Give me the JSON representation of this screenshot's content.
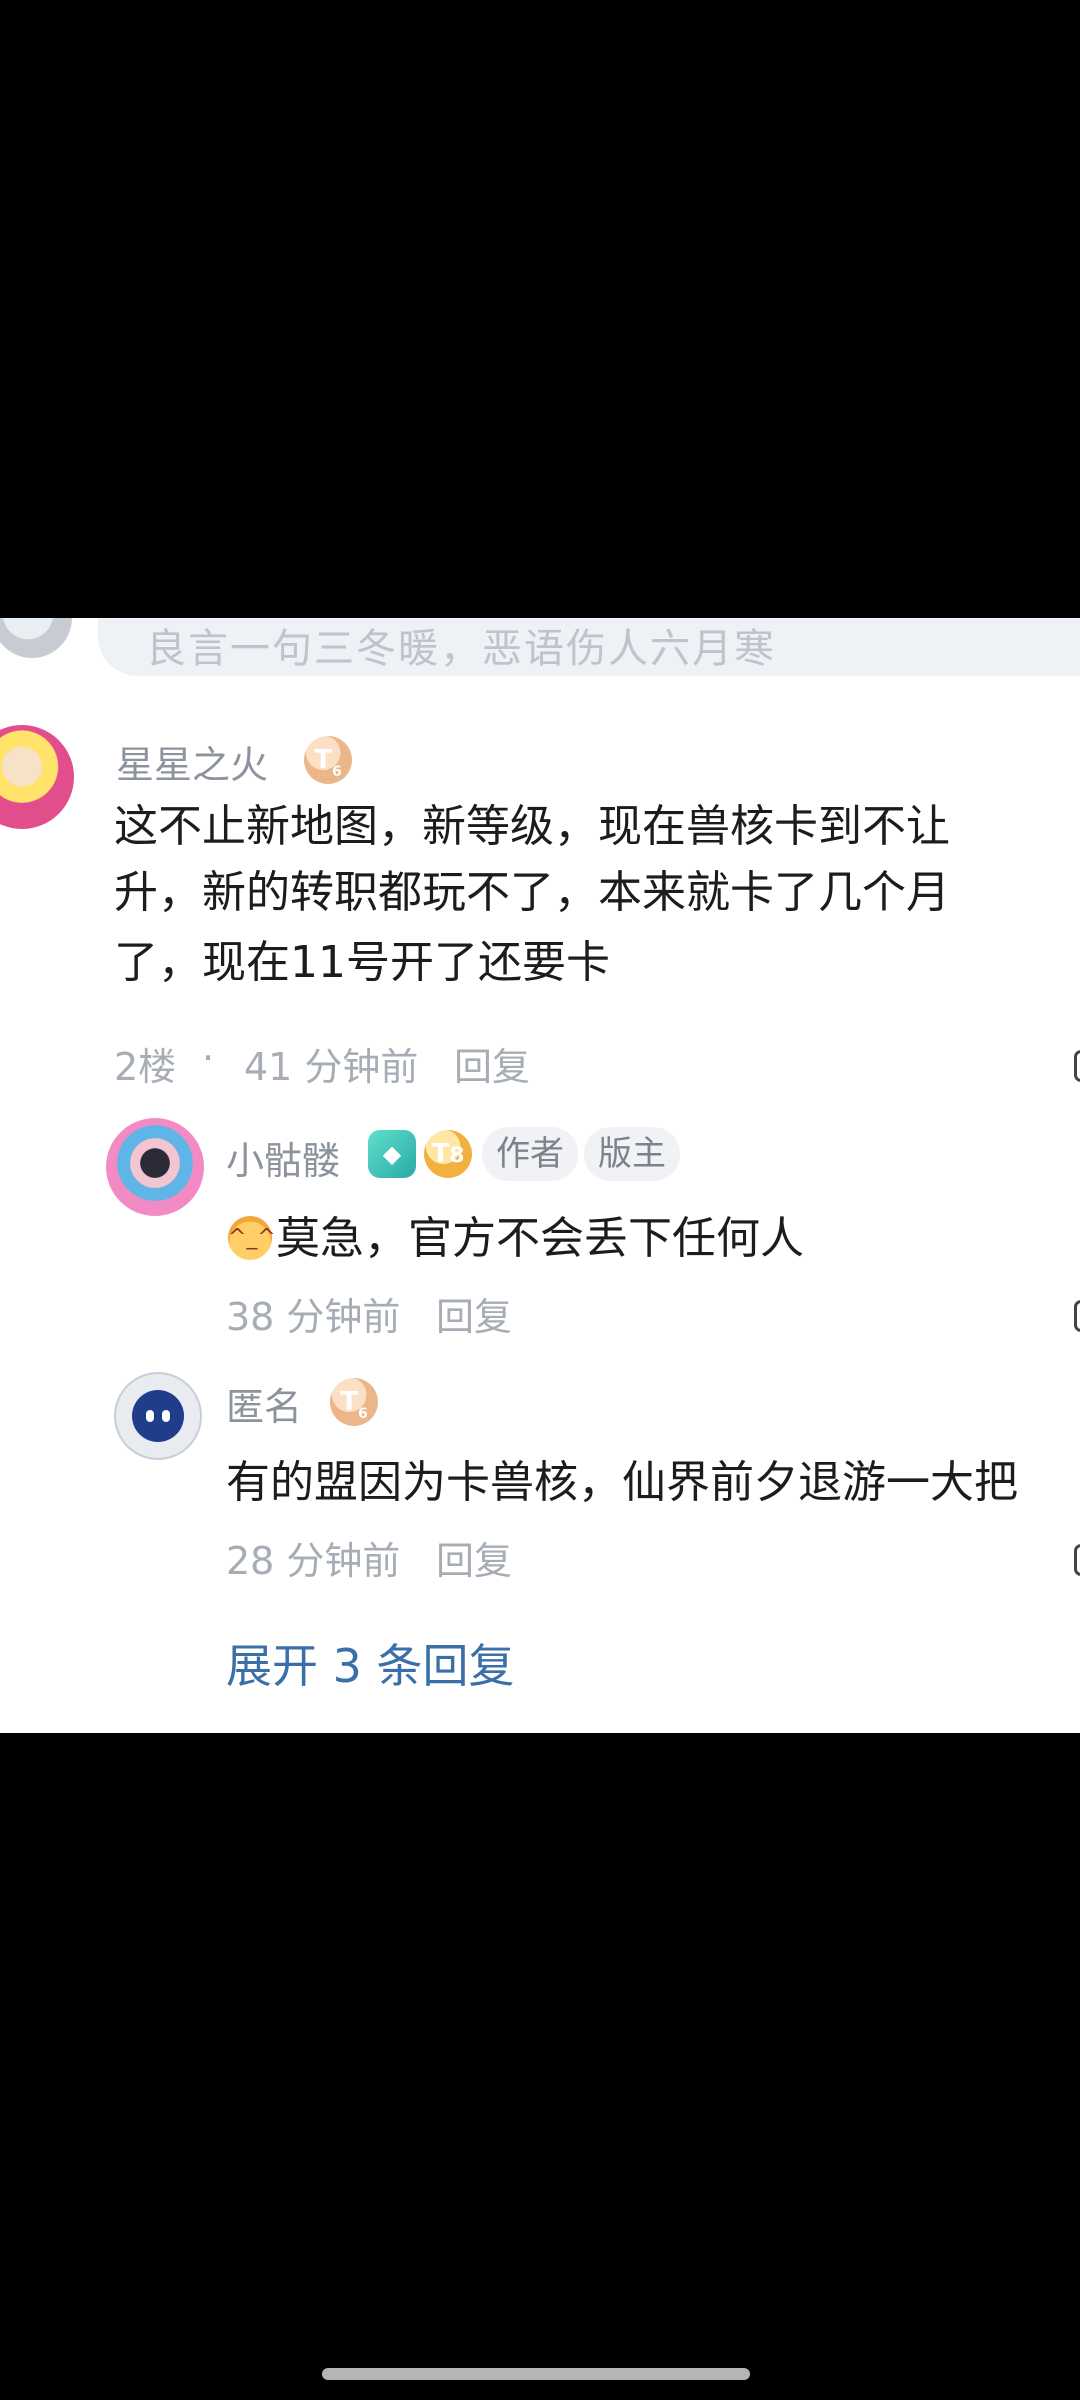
{
  "prev_comment": {
    "partial_text": "良言一句三冬暖，恶语伤人六月寒"
  },
  "comment": {
    "username": "星星之火",
    "badge": "T",
    "text_lines": [
      "这不止新地图，新等级，现在兽核卡到不让",
      "升，新的转职都玩不了，本来就卡了几个月",
      "了，现在11号开了还要卡"
    ],
    "floor": "2楼",
    "separator": "·",
    "time": "41 分钟前",
    "reply_label": "回复"
  },
  "replies": [
    {
      "username": "小骷髅",
      "badges": [
        "T"
      ],
      "tags": [
        "作者",
        "版主"
      ],
      "text": "莫急，官方不会丢下任何人",
      "time": "38 分钟前",
      "reply_label": "回复"
    },
    {
      "username": "匿名",
      "badges": [
        "T"
      ],
      "text": "有的盟因为卡兽核，仙界前夕退游一大把",
      "time": "28 分钟前",
      "reply_label": "回复"
    }
  ],
  "expand_label": "展开 3 条回复",
  "colors": {
    "background": "#000000",
    "panel": "#ffffff",
    "username": "#8c939d",
    "link": "#3a6fa8"
  }
}
